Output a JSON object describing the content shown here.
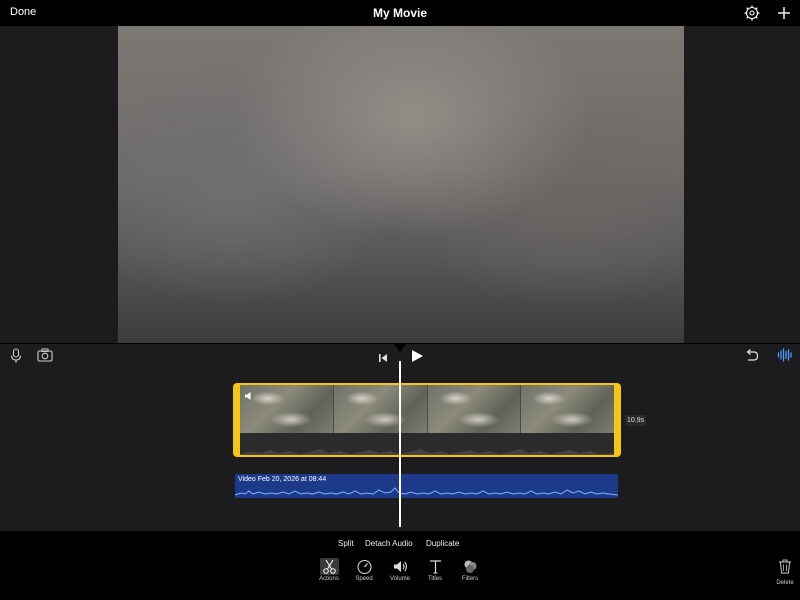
{
  "topbar": {
    "done_label": "Done",
    "title": "My Movie",
    "icons": [
      "gear-icon",
      "plus-icon"
    ]
  },
  "timeline": {
    "clip_duration": "10.9s",
    "audio_clip_label": "Video Feb 20, 2026 at 08:44",
    "icons": [
      "microphone-icon",
      "camera-icon",
      "skip-to-start-icon",
      "play-icon",
      "undo-icon",
      "waveform-icon"
    ]
  },
  "actions": {
    "split": "Split",
    "detach_audio": "Detach Audio",
    "duplicate": "Duplicate"
  },
  "tools": {
    "actions": "Actions",
    "speed": "Speed",
    "volume": "Volume",
    "titles": "Titles",
    "filters": "Filters",
    "delete": "Delete"
  },
  "colors": {
    "clip_border": "#f5c518",
    "audio_track": "#1d3a8a",
    "waveform_accent": "#4a9eff"
  }
}
